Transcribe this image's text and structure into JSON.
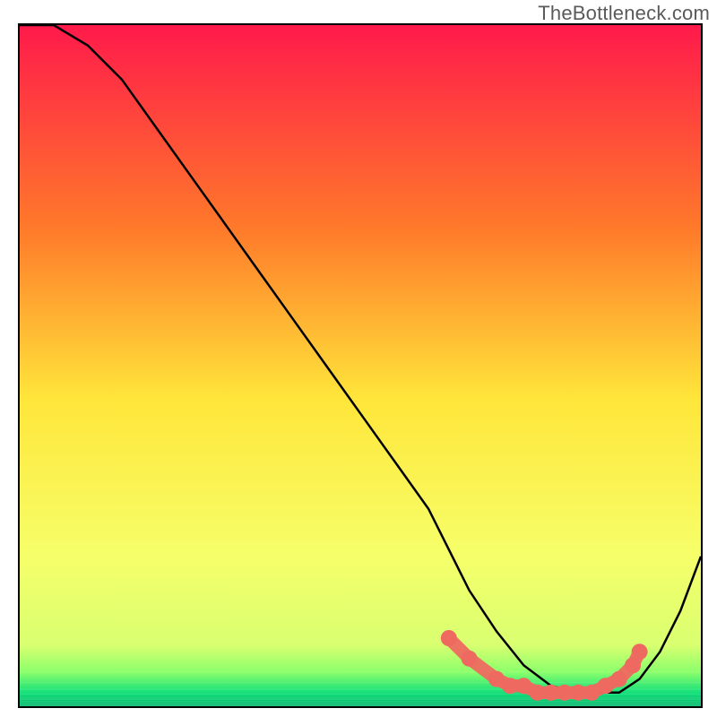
{
  "watermark": "TheBottleneck.com",
  "colors": {
    "gradient_top": "#ff1a4b",
    "gradient_mid1": "#ff7a2a",
    "gradient_mid2": "#ffe63a",
    "gradient_mid3": "#f6ff6a",
    "gradient_bottom1": "#8bff6b",
    "gradient_bottom2": "#14e07a",
    "gradient_bottom3": "#00b86b",
    "curve": "#000000",
    "marker": "#ee6a60"
  },
  "chart_data": {
    "type": "line",
    "title": "",
    "xlabel": "",
    "ylabel": "",
    "xlim": [
      0,
      100
    ],
    "ylim": [
      0,
      100
    ],
    "series": [
      {
        "name": "bottleneck-curve",
        "x": [
          0,
          5,
          10,
          15,
          20,
          25,
          30,
          35,
          40,
          45,
          50,
          55,
          60,
          63,
          66,
          70,
          74,
          78,
          82,
          85,
          88,
          91,
          94,
          97,
          100
        ],
        "y": [
          100,
          100,
          97,
          92,
          85,
          78,
          71,
          64,
          57,
          50,
          43,
          36,
          29,
          23,
          17,
          11,
          6,
          3,
          2,
          2,
          2,
          4,
          8,
          14,
          22
        ]
      }
    ],
    "markers": {
      "name": "highlight-region",
      "x": [
        63,
        66,
        70,
        72,
        74,
        76,
        78,
        80,
        82,
        84,
        86,
        88,
        90,
        91
      ],
      "y": [
        10,
        7,
        4,
        3,
        3,
        2,
        2,
        2,
        2,
        2,
        3,
        4,
        6,
        8
      ]
    },
    "gradient_bands_y": [
      0,
      72,
      80,
      85,
      90,
      93,
      95,
      96.5,
      97.5,
      98.2,
      98.8,
      99.0,
      99.3,
      99.5,
      99.7,
      99.85,
      100
    ]
  }
}
